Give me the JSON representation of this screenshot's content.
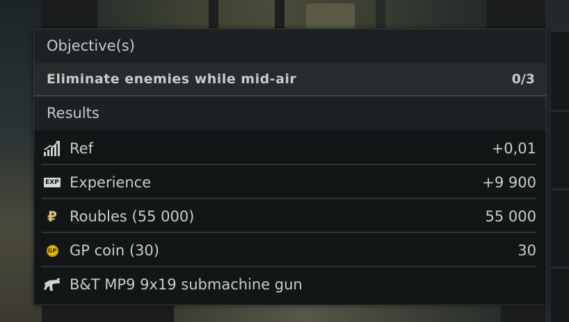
{
  "objectives": {
    "heading": "Objective(s)",
    "items": [
      {
        "text": "Eliminate enemies while mid-air",
        "progress": "0/3"
      }
    ]
  },
  "results": {
    "heading": "Results",
    "rows": [
      {
        "icon": "reputation-chart-icon",
        "label": "Ref",
        "value": "+0,01"
      },
      {
        "icon": "exp-badge-icon",
        "icon_text": "EXP",
        "label": "Experience",
        "value": "+9 900"
      },
      {
        "icon": "rouble-icon",
        "icon_text": "₽",
        "label": "Roubles (55 000)",
        "value": "55 000"
      },
      {
        "icon": "gp-coin-icon",
        "icon_text": "GP",
        "label": "GP coin (30)",
        "value": "30"
      },
      {
        "icon": "submachine-gun-icon",
        "label": "B&T MP9 9x19 submachine gun",
        "value": ""
      }
    ]
  },
  "colors": {
    "panel_bg": "#131617",
    "section_header_bg": "#1c2123",
    "objective_row_bg": "#262c2e",
    "text": "#c9ccc7",
    "gp_coin": "#e6c012",
    "rouble": "#d8c07a"
  }
}
